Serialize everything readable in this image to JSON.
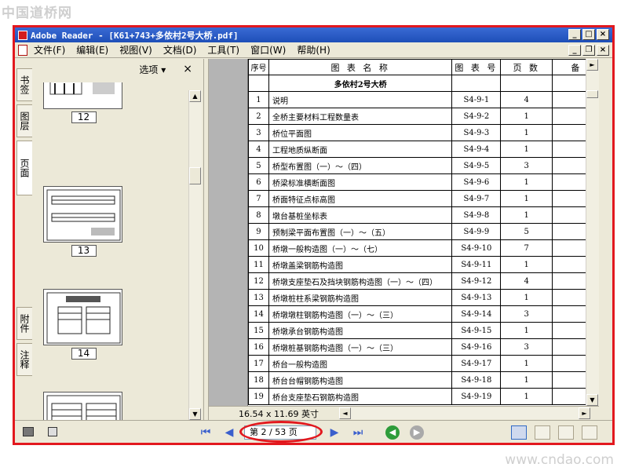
{
  "watermark_top": "中国道桥网",
  "watermark_bottom": "www.cndao.com",
  "window": {
    "title": "Adobe Reader - [K61+743+多依村2号大桥.pdf]",
    "minimize": "_",
    "maximize": "□",
    "close": "×",
    "restore": "❐"
  },
  "menu": [
    "文件(F)",
    "编辑(E)",
    "视图(V)",
    "文档(D)",
    "工具(T)",
    "窗口(W)",
    "帮助(H)"
  ],
  "side_tabs": {
    "bookmarks": "书签",
    "layers": "图层",
    "pages": "页面",
    "attachments": "附件",
    "comments": "注释"
  },
  "panel": {
    "options_label": "选项 ▾",
    "close_label": "×"
  },
  "thumbnails": [
    "12",
    "13",
    "14"
  ],
  "table": {
    "headers": [
      "序号",
      "图 表 名 称",
      "图 表 号",
      "页 数",
      "备 注"
    ],
    "section_title": "多依村2号大桥",
    "rows": [
      [
        "1",
        "说明",
        "S4-9-1",
        "4"
      ],
      [
        "2",
        "全桥主要材料工程数量表",
        "S4-9-2",
        "1"
      ],
      [
        "3",
        "桥位平面图",
        "S4-9-3",
        "1"
      ],
      [
        "4",
        "工程地质纵断面",
        "S4-9-4",
        "1"
      ],
      [
        "5",
        "桥型布置图（一）～（四）",
        "S4-9-5",
        "3"
      ],
      [
        "6",
        "桥梁标准横断面图",
        "S4-9-6",
        "1"
      ],
      [
        "7",
        "桥面特征点标高图",
        "S4-9-7",
        "1"
      ],
      [
        "8",
        "墩台基桩坐标表",
        "S4-9-8",
        "1"
      ],
      [
        "9",
        "预制梁平面布置图（一）～（五）",
        "S4-9-9",
        "5"
      ],
      [
        "10",
        "桥墩一般构造图（一）～（七）",
        "S4-9-10",
        "7"
      ],
      [
        "11",
        "桥墩盖梁钢筋构造图",
        "S4-9-11",
        "1"
      ],
      [
        "12",
        "桥墩支座垫石及挡块钢筋构造图（一）～（四）",
        "S4-9-12",
        "4"
      ],
      [
        "13",
        "桥墩桩柱系梁钢筋构造图",
        "S4-9-13",
        "1"
      ],
      [
        "14",
        "桥墩墩柱钢筋构造图（一）～（三）",
        "S4-9-14",
        "3"
      ],
      [
        "15",
        "桥墩承台钢筋构造图",
        "S4-9-15",
        "1"
      ],
      [
        "16",
        "桥墩桩基钢筋构造图（一）～（三）",
        "S4-9-16",
        "3"
      ],
      [
        "17",
        "桥台一般构造图",
        "S4-9-17",
        "1"
      ],
      [
        "18",
        "桥台台帽钢筋构造图",
        "S4-9-18",
        "1"
      ],
      [
        "19",
        "桥台支座垫石钢筋构造图",
        "S4-9-19",
        "1"
      ]
    ]
  },
  "page_size": "16.54 x 11.69 英寸",
  "page_field": "第 2 / 53 页",
  "colors": {
    "highlight": "#e2181e",
    "titlebar": "#1e4fb8",
    "nav_icon": "#3a5fcd",
    "go_back": "#2e9c3a",
    "go_forward": "#a9a9a9"
  }
}
